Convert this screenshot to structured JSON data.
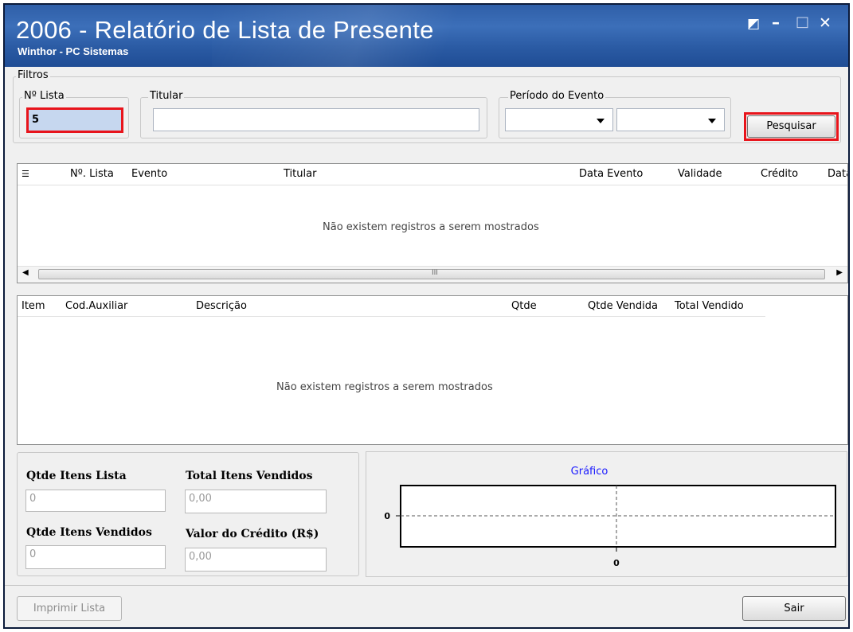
{
  "window": {
    "title": "2006 - Relatório de Lista de Presente",
    "subtitle": "Winthor - PC Sistemas",
    "controls": {
      "restore": "◩",
      "minimize": "–",
      "maximize": "□",
      "close": "✕"
    }
  },
  "filters": {
    "group_label": "Filtros",
    "num_lista_label": "Nº Lista",
    "num_lista_value": "5",
    "titular_label": "Titular",
    "titular_value": "",
    "periodo_label": "Período do Evento",
    "periodo_start": "",
    "periodo_end": "",
    "search_button": "Pesquisar"
  },
  "lists_grid": {
    "columns": [
      "Nº. Lista",
      "Evento",
      "Titular",
      "Data Evento",
      "Validade",
      "Crédito",
      "Data"
    ],
    "empty_message": "Não existem registros a serem mostrados",
    "scroll_grip": "III"
  },
  "items_grid": {
    "columns": [
      "Item",
      "Cod.Auxiliar",
      "Descrição",
      "Qtde",
      "Qtde Vendida",
      "Total Vendido"
    ],
    "empty_message": "Não existem registros a serem mostrados"
  },
  "summary": {
    "qtde_itens_lista_label": "Qtde Itens Lista",
    "qtde_itens_lista_value": "0",
    "total_itens_vendidos_label": "Total Itens Vendidos",
    "total_itens_vendidos_value": "0,00",
    "qtde_itens_vendidos_label": "Qtde Itens Vendidos",
    "qtde_itens_vendidos_value": "0",
    "valor_credito_label": "Valor do Crédito (R$)",
    "valor_credito_value": "0,00"
  },
  "chart": {
    "title": "Gráfico",
    "y_tick": "0",
    "x_tick": "0",
    "title_color": "#1a1aff"
  },
  "footer": {
    "print_button": "Imprimir Lista",
    "exit_button": "Sair"
  },
  "chart_data": {
    "type": "line",
    "title": "Gráfico",
    "series": [],
    "x_ticks": [
      "0"
    ],
    "y_ticks": [
      "0"
    ],
    "grid": true
  }
}
